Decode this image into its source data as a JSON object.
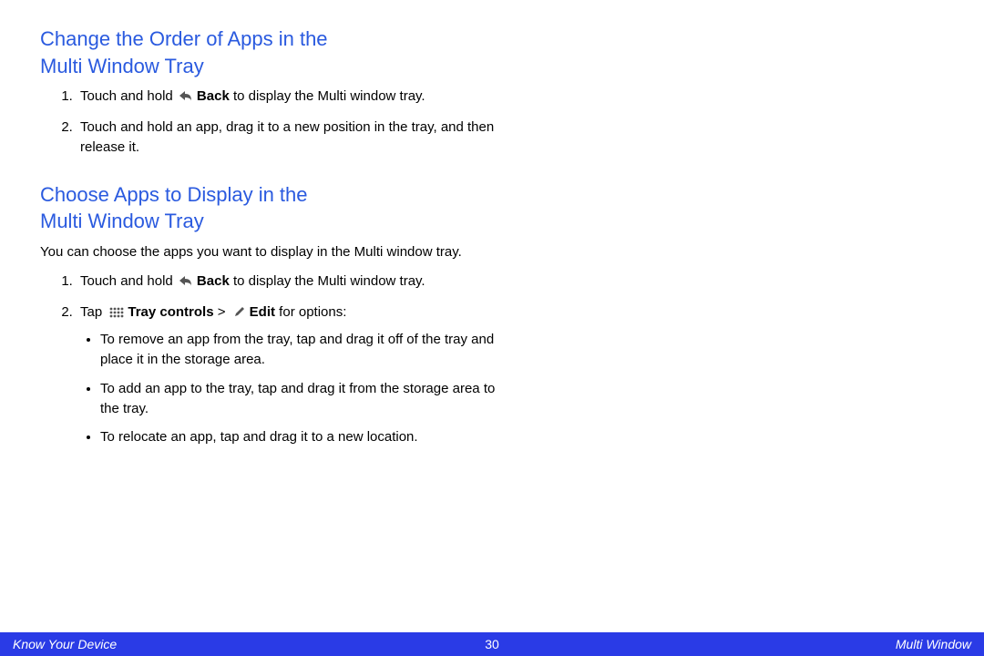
{
  "section1": {
    "heading_l1": "Change the Order of Apps in the",
    "heading_l2": "Multi Window Tray",
    "steps": {
      "s1_pre": "Touch and hold ",
      "s1_bold": "Back",
      "s1_post": " to display the Multi window tray.",
      "s2": "Touch and hold an app, drag it to a new position in the tray, and then release it."
    }
  },
  "section2": {
    "heading_l1": "Choose Apps to Display in the",
    "heading_l2": "Multi Window Tray",
    "intro": "You can choose the apps you want to display in the Multi window tray.",
    "steps": {
      "s1_pre": "Touch and hold ",
      "s1_bold": "Back",
      "s1_post": " to display the Multi window tray.",
      "s2_pre": "Tap ",
      "s2_bold1": "Tray controls",
      "s2_mid": " > ",
      "s2_bold2": "Edit",
      "s2_post": " for options:"
    },
    "bullets": {
      "b1": "To remove an app from the tray, tap and drag it off of the tray and place it in the storage area.",
      "b2": "To add an app to the tray, tap and drag it from the storage area to the tray.",
      "b3": "To relocate an app, tap and drag it to a new location."
    }
  },
  "footer": {
    "left": "Know Your Device",
    "center": "30",
    "right": "Multi Window"
  },
  "icons": {
    "back": "back-icon",
    "dots": "dots-icon",
    "pencil": "pencil-icon"
  }
}
